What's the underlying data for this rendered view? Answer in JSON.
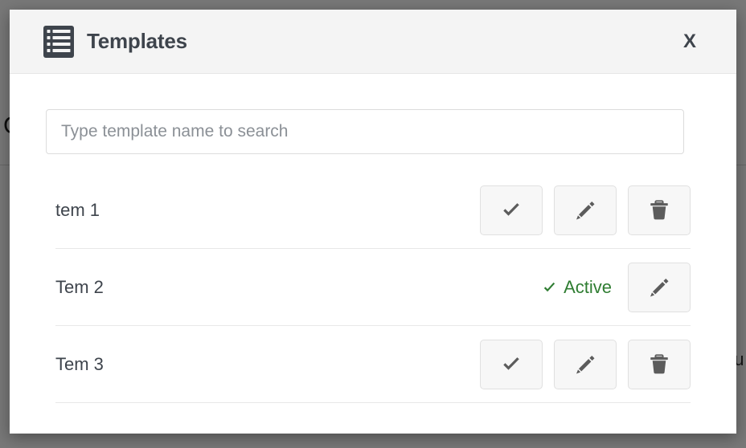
{
  "background": {
    "left_fragment": "C",
    "right_fragment": "su"
  },
  "modal": {
    "header": {
      "icon": "templates-list-icon",
      "title": "Templates",
      "close_label": "X"
    },
    "search": {
      "icon": "",
      "value": "",
      "placeholder": "Type template name to search"
    },
    "templates": [
      {
        "name": "tem 1",
        "active": false,
        "active_label": "",
        "actions": [
          "check",
          "edit",
          "delete"
        ]
      },
      {
        "name": "Tem 2",
        "active": true,
        "active_label": "Active",
        "actions": [
          "edit"
        ]
      },
      {
        "name": "Tem 3",
        "active": false,
        "active_label": "",
        "actions": [
          "check",
          "edit",
          "delete"
        ]
      }
    ]
  },
  "colors": {
    "active_green": "#2f7d32",
    "title_dark": "#3e444c",
    "icon_gray": "#666666",
    "header_bg": "#f4f4f4",
    "button_bg": "#f7f7f7",
    "overlay": "#000000"
  }
}
